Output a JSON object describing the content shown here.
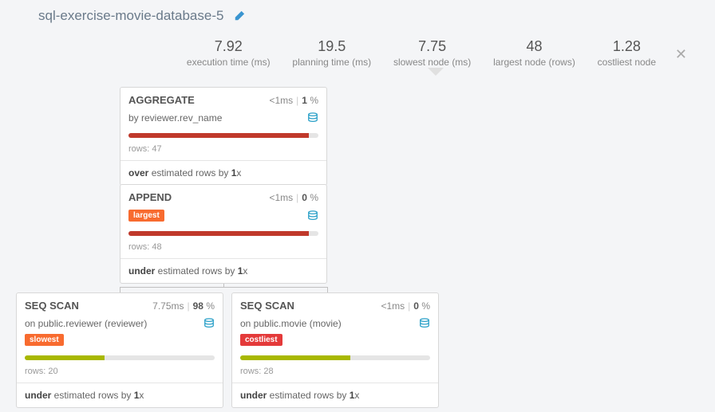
{
  "title": "sql-exercise-movie-database-5",
  "stats": [
    {
      "value": "7.92",
      "label": "execution time (ms)"
    },
    {
      "value": "19.5",
      "label": "planning time (ms)"
    },
    {
      "value": "7.75",
      "label": "slowest node (ms)"
    },
    {
      "value": "48",
      "label": "largest node (rows)"
    },
    {
      "value": "1.28",
      "label": "costliest node"
    }
  ],
  "nodes": {
    "aggregate": {
      "type": "AGGREGATE",
      "time": "<1",
      "time_unit": "ms",
      "pct": "1",
      "pct_unit": " %",
      "subtitle": "by reviewer.rev_name",
      "rows": "rows: 47",
      "bar_pct": 95,
      "bar_color": "#c0392b",
      "est_pre": "over",
      "est_mid": " estimated rows by ",
      "est_val": "1",
      "est_suf": "x"
    },
    "append": {
      "type": "APPEND",
      "time": "<1",
      "time_unit": "ms",
      "pct": "0",
      "pct_unit": " %",
      "tag": "largest",
      "rows": "rows: 48",
      "bar_pct": 95,
      "bar_color": "#c0392b",
      "est_pre": "under",
      "est_mid": " estimated rows by ",
      "est_val": "1",
      "est_suf": "x"
    },
    "seq1": {
      "type": "SEQ SCAN",
      "time": "7.75",
      "time_unit": "ms",
      "pct": "98",
      "pct_unit": " %",
      "subtitle": "on public.reviewer (reviewer)",
      "tag": "slowest",
      "rows": "rows: 20",
      "bar_pct": 42,
      "bar_color": "#a8b800",
      "est_pre": "under",
      "est_mid": " estimated rows by ",
      "est_val": "1",
      "est_suf": "x"
    },
    "seq2": {
      "type": "SEQ SCAN",
      "time": "<1",
      "time_unit": "ms",
      "pct": "0",
      "pct_unit": " %",
      "subtitle": "on public.movie (movie)",
      "tag": "costliest",
      "rows": "rows: 28",
      "bar_pct": 58,
      "bar_color": "#a8b800",
      "est_pre": "under",
      "est_mid": " estimated rows by ",
      "est_val": "1",
      "est_suf": "x"
    }
  }
}
